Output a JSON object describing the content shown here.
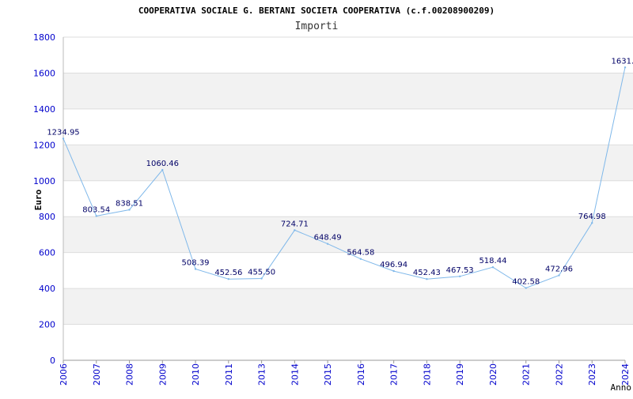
{
  "chart_data": {
    "type": "line",
    "title": "COOPERATIVA SOCIALE G. BERTANI SOCIETA COOPERATIVA (c.f.00208900209)",
    "subtitle": "Importi",
    "xlabel": "Anno",
    "ylabel": "Euro",
    "ylim": [
      0,
      1800
    ],
    "yticks": [
      "0",
      "200",
      "400",
      "600",
      "800",
      "1000",
      "1200",
      "1400",
      "1600",
      "1800"
    ],
    "grid": "horizontal bands",
    "categories": [
      "2006",
      "2007",
      "2008",
      "2009",
      "2010",
      "2011",
      "2013",
      "2014",
      "2015",
      "2016",
      "2017",
      "2018",
      "2019",
      "2020",
      "2021",
      "2022",
      "2023",
      "2024"
    ],
    "series": [
      {
        "values": [
          1234.95,
          803.54,
          838.51,
          1060.46,
          508.39,
          452.56,
          455.5,
          724.71,
          648.49,
          564.58,
          496.94,
          452.43,
          467.53,
          518.44,
          402.58,
          472.96,
          764.98,
          1631.4
        ],
        "labels": [
          "1234.95",
          "803.54",
          "838.51",
          "1060.46",
          "508.39",
          "452.56",
          "455.50",
          "724.71",
          "648.49",
          "564.58",
          "496.94",
          "452.43",
          "467.53",
          "518.44",
          "402.58",
          "472.96",
          "764.98",
          "1631.4"
        ]
      }
    ],
    "colors": {
      "line": "#7fb8ea",
      "axis_text": "#0000cc",
      "band": "#f2f2f2",
      "gridline": "#dddddd",
      "title_text": "#000000"
    }
  }
}
